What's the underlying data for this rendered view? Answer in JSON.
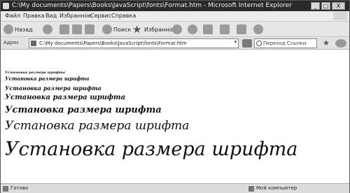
{
  "window": {
    "title": "C:\\My documents\\Papers\\Books\\JavaScript\\fonts\\Format.htm - Microsoft Internet Explorer",
    "minimize_glyph": "_",
    "maximize_glyph": "□",
    "close_glyph": "X"
  },
  "menu": {
    "items": [
      "Файл",
      "Правка",
      "Вид",
      "Избранное",
      "Сервис",
      "Справка"
    ]
  },
  "toolbar": {
    "back_label": "Назад",
    "search_label": "Поиск",
    "favorites_label": "Избранное"
  },
  "address": {
    "label": "Адрес",
    "value": "C:\\My documents\\Papers\\Books\\JavaScript\\fonts\\Format.htm",
    "dropdown_glyph": "▾",
    "search_text": "Переход  Ссылки"
  },
  "content": {
    "lines": [
      "Установка размера шрифта",
      "Установка размера шрифта",
      "Установка размера шрифта",
      "Установка размера шрифта",
      "Установка размера шрифта",
      "Установка размера шрифта",
      "Установка размера шрифта"
    ]
  },
  "status": {
    "text": "Готово",
    "zone": "Мой компьютер"
  },
  "icons": {
    "back": "back-arrow-icon",
    "forward": "forward-arrow-icon",
    "stop": "stop-icon",
    "refresh": "refresh-icon",
    "home": "home-icon",
    "search": "search-icon",
    "favorites": "star-icon",
    "media": "media-icon",
    "mail": "mail-icon",
    "print": "print-icon"
  }
}
